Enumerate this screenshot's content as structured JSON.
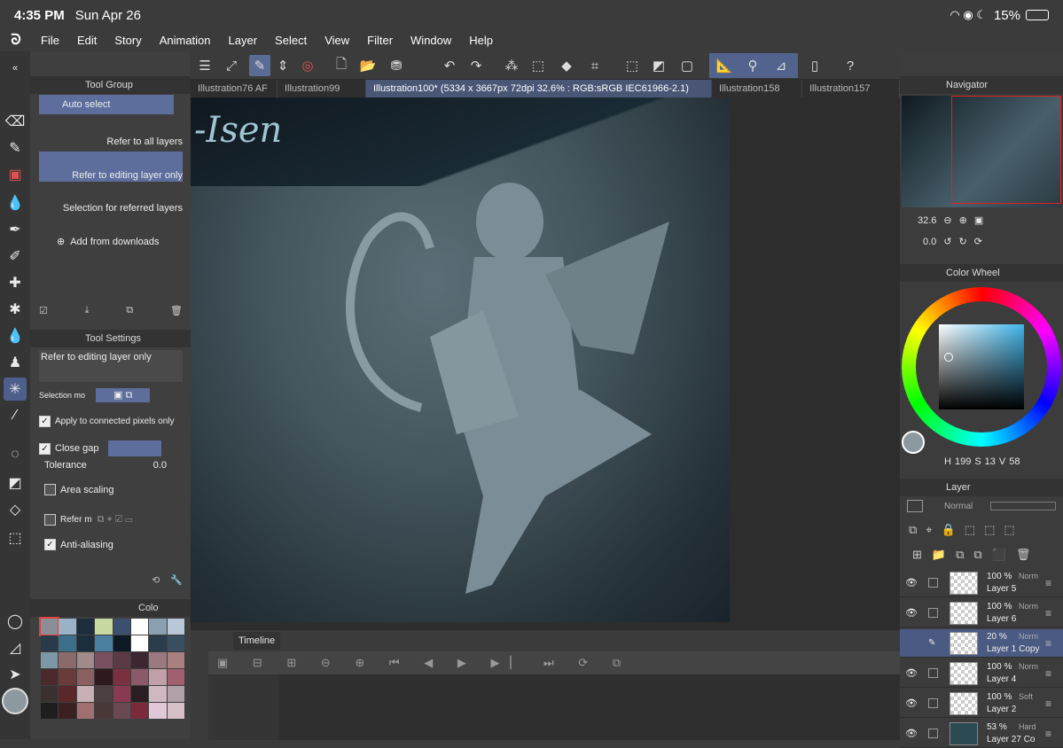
{
  "status": {
    "time": "4:35 PM",
    "date": "Sun Apr 26",
    "battery": "15%"
  },
  "menu": [
    "File",
    "Edit",
    "Story",
    "Animation",
    "Layer",
    "Select",
    "View",
    "Filter",
    "Window",
    "Help"
  ],
  "tabs": [
    {
      "label": "Illustration76 AF"
    },
    {
      "label": "Illustration99"
    },
    {
      "label": "Illustration100* (5334 x 3667px 72dpi 32.6% : RGB:sRGB IEC61966-2.1)"
    },
    {
      "label": "Illustration158"
    },
    {
      "label": "Illustration157"
    }
  ],
  "canvas_text": "-Isen",
  "tool_group": {
    "title": "Tool Group",
    "items": [
      "Auto select",
      "Refer to all layers",
      "Refer to editing layer only",
      "Selection for referred layers"
    ],
    "add": "Add from downloads"
  },
  "tool_settings": {
    "title": "Tool Settings",
    "preset": "Refer to editing layer only",
    "selection_mode": "Selection mo",
    "apply_connected": "Apply to connected pixels only",
    "close_gap": "Close gap",
    "tolerance_label": "Tolerance",
    "tolerance_value": "0.0",
    "area_scaling": "Area scaling",
    "refer": "Refer m",
    "anti_aliasing": "Anti-aliasing"
  },
  "color_tab": "Colo",
  "palette": [
    "#8a8f96",
    "#9bb3c6",
    "#1e2d3e",
    "#c7d9a0",
    "#3d4f6e",
    "#ffffff",
    "#8aa0b0",
    "#b8c8d8",
    "#2a3a4a",
    "#3d6e8a",
    "#1b2e3b",
    "#4a7fa0",
    "#0d1a24",
    "#ffffff",
    "#2b3c4c",
    "#3a4f60",
    "#7e97a6",
    "#8a6a6a",
    "#a08a8a",
    "#7a5060",
    "#5a3a44",
    "#3d2630",
    "#9a7a80",
    "#a88080",
    "#4a2a2a",
    "#6b3a3a",
    "#8a6060",
    "#2e1a1e",
    "#7a3040",
    "#8a5a6a",
    "#c0a0a8",
    "#a06070",
    "#3a3030",
    "#5a2828",
    "#c8b0b4",
    "#4a4040",
    "#8a3a50",
    "#2a1e22",
    "#d0b8c0",
    "#b0a0a8",
    "#1e1e1e",
    "#3a2020",
    "#a07070",
    "#4a3838",
    "#6a4a50",
    "#7a2a3a",
    "#e0c8d8",
    "#d8c0c8"
  ],
  "navigator": {
    "title": "Navigator",
    "zoom": "32.6",
    "rotation": "0.0"
  },
  "color_wheel": {
    "title": "Color Wheel",
    "h": "199",
    "s": "13",
    "v": "58",
    "h_label": "H",
    "s_label": "S",
    "v_label": "V"
  },
  "layer_panel": {
    "title": "Layer",
    "blend": "Normal",
    "layers": [
      {
        "opacity": "100 %",
        "mode": "Norm",
        "name": "Layer 5"
      },
      {
        "opacity": "100 %",
        "mode": "Norm",
        "name": "Layer 6"
      },
      {
        "opacity": "20 %",
        "mode": "Norm",
        "name": "Layer 1 Copy"
      },
      {
        "opacity": "100 %",
        "mode": "Norm",
        "name": "Layer 4"
      },
      {
        "opacity": "100 %",
        "mode": "Soft",
        "name": "Layer 2"
      },
      {
        "opacity": "53 %",
        "mode": "Hard",
        "name": "Layer 27 Co"
      }
    ]
  },
  "timeline": {
    "title": "Timeline"
  },
  "colors": {
    "accent": "#5a6b95",
    "panel": "#3f3f3f",
    "selection": "#5d6d9c"
  }
}
